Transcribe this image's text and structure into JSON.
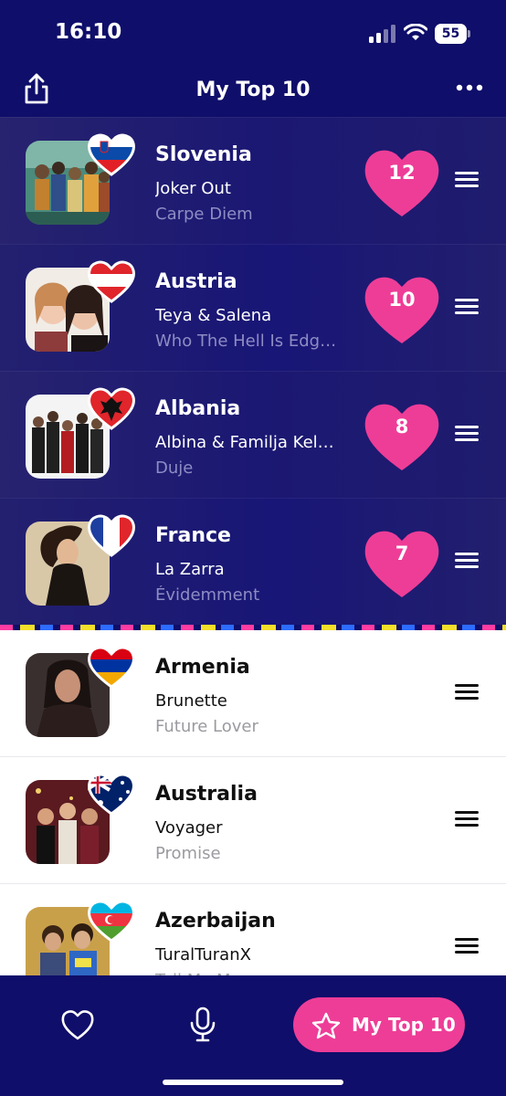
{
  "status_bar": {
    "time": "16:10",
    "battery": "55"
  },
  "header": {
    "title": "My Top 10",
    "share_icon": "share-icon",
    "more_icon": "more-icon"
  },
  "top10": [
    {
      "country": "Slovenia",
      "artist": "Joker Out",
      "song": "Carpe Diem",
      "points": "12",
      "flag": "slovenia"
    },
    {
      "country": "Austria",
      "artist": "Teya & Salena",
      "song": "Who The Hell Is Edg…",
      "points": "10",
      "flag": "austria"
    },
    {
      "country": "Albania",
      "artist": "Albina & Familja Kel…",
      "song": "Duje",
      "points": "8",
      "flag": "albania"
    },
    {
      "country": "France",
      "artist": "La Zarra",
      "song": "Évidemment",
      "points": "7",
      "flag": "france"
    }
  ],
  "others": [
    {
      "country": "Armenia",
      "artist": "Brunette",
      "song": "Future Lover",
      "flag": "armenia"
    },
    {
      "country": "Australia",
      "artist": "Voyager",
      "song": "Promise",
      "flag": "australia"
    },
    {
      "country": "Azerbaijan",
      "artist": "TuralTuranX",
      "song": "Tell Me More",
      "flag": "azerbaijan"
    }
  ],
  "tabbar": {
    "favorites_icon": "heart-icon",
    "mic_icon": "microphone-icon",
    "top10_label": "My Top 10"
  },
  "colors": {
    "navy": "#0f0e6a",
    "pink": "#ee3d97"
  }
}
